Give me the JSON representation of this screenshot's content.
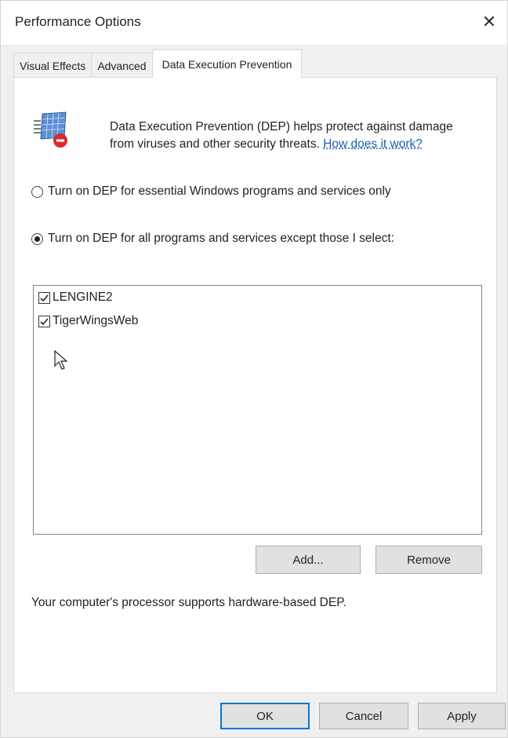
{
  "window": {
    "title": "Performance Options",
    "close_glyph": "✕"
  },
  "tabs": [
    {
      "label": "Visual Effects",
      "active": false
    },
    {
      "label": "Advanced",
      "active": false
    },
    {
      "label": "Data Execution Prevention",
      "active": true
    }
  ],
  "dep": {
    "icon": "dep-shield-icon",
    "intro_text": "Data Execution Prevention (DEP) helps protect against damage from viruses and other security threats.",
    "link_text": "How does it work?",
    "options": [
      {
        "label": "Turn on DEP for essential Windows programs and services only",
        "selected": false
      },
      {
        "label": "Turn on DEP for all programs and services except those I select:",
        "selected": true
      }
    ],
    "exceptions": [
      {
        "label": "LENGINE2",
        "checked": true
      },
      {
        "label": "TigerWingsWeb",
        "checked": true
      }
    ],
    "add_label": "Add...",
    "remove_label": "Remove",
    "hardware_note": "Your computer's processor supports hardware-based DEP."
  },
  "footer": {
    "ok_label": "OK",
    "cancel_label": "Cancel",
    "apply_label": "Apply"
  },
  "colors": {
    "accent": "#0078d7",
    "link": "#1a5fb4",
    "dialog_bg": "#f0f0f0",
    "panel_bg": "#ffffff"
  }
}
